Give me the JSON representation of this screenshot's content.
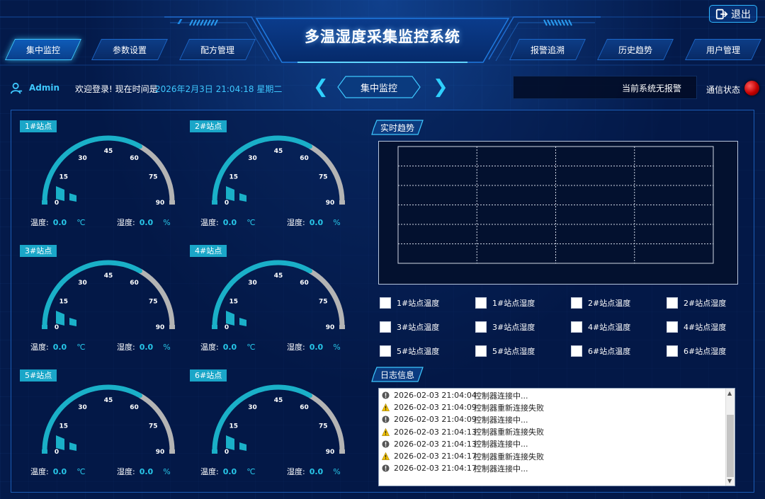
{
  "header": {
    "title": "多温湿度采集监控系统",
    "logout_label": "退出",
    "nav": [
      {
        "label": "集中监控",
        "active": true
      },
      {
        "label": "参数设置",
        "active": false
      },
      {
        "label": "配方管理",
        "active": false
      },
      {
        "label": "报警追溯",
        "active": false
      },
      {
        "label": "历史趋势",
        "active": false
      },
      {
        "label": "用户管理",
        "active": false
      }
    ]
  },
  "info_bar": {
    "user": "Admin",
    "welcome": "欢迎登录! 现在时间是",
    "time": "2026年2月3日 21:04:18 星期二",
    "prev_icon": "double-chevron-left-icon",
    "next_icon": "double-chevron-right-icon",
    "current_view": "集中监控",
    "alarm_text": "当前系统无报警",
    "comm_label": "通信状态",
    "comm_status_color": "#d10000"
  },
  "gauge_scale": [
    "0",
    "15",
    "30",
    "45",
    "60",
    "75",
    "90"
  ],
  "stations": [
    {
      "name": "1#站点",
      "temp_label": "温度:",
      "temp_value": "0.0",
      "temp_unit": "℃",
      "hum_label": "湿度:",
      "hum_value": "0.0",
      "hum_unit": "%"
    },
    {
      "name": "2#站点",
      "temp_label": "温度:",
      "temp_value": "0.0",
      "temp_unit": "℃",
      "hum_label": "湿度:",
      "hum_value": "0.0",
      "hum_unit": "%"
    },
    {
      "name": "3#站点",
      "temp_label": "温度:",
      "temp_value": "0.0",
      "temp_unit": "℃",
      "hum_label": "湿度:",
      "hum_value": "0.0",
      "hum_unit": "%"
    },
    {
      "name": "4#站点",
      "temp_label": "温度:",
      "temp_value": "0.0",
      "temp_unit": "℃",
      "hum_label": "湿度:",
      "hum_value": "0.0",
      "hum_unit": "%"
    },
    {
      "name": "5#站点",
      "temp_label": "温度:",
      "temp_value": "0.0",
      "temp_unit": "℃",
      "hum_label": "湿度:",
      "hum_value": "0.0",
      "hum_unit": "%"
    },
    {
      "name": "6#站点",
      "temp_label": "温度:",
      "temp_value": "0.0",
      "temp_unit": "℃",
      "hum_label": "湿度:",
      "hum_value": "0.0",
      "hum_unit": "%"
    }
  ],
  "trend": {
    "title": "实时趋势",
    "legend": [
      "1#站点温度",
      "1#站点湿度",
      "2#站点温度",
      "2#站点湿度",
      "3#站点温度",
      "3#站点湿度",
      "4#站点温度",
      "4#站点湿度",
      "5#站点温度",
      "5#站点湿度",
      "6#站点温度",
      "6#站点湿度"
    ]
  },
  "log": {
    "title": "日志信息",
    "entries": [
      {
        "type": "info",
        "time": "2026-02-03 21:04:04",
        "message": "控制器连接中..."
      },
      {
        "type": "warn",
        "time": "2026-02-03 21:04:09",
        "message": "控制器重新连接失败"
      },
      {
        "type": "info",
        "time": "2026-02-03 21:04:09",
        "message": "控制器连接中..."
      },
      {
        "type": "warn",
        "time": "2026-02-03 21:04:13",
        "message": "控制器重新连接失败"
      },
      {
        "type": "info",
        "time": "2026-02-03 21:04:13",
        "message": "控制器连接中..."
      },
      {
        "type": "warn",
        "time": "2026-02-03 21:04:17",
        "message": "控制器重新连接失败"
      },
      {
        "type": "info",
        "time": "2026-02-03 21:04:17",
        "message": "控制器连接中..."
      }
    ]
  },
  "colors": {
    "accent": "#3ec8ff",
    "gauge_teal": "#1ab0c8",
    "gauge_grey": "#b4b4b4",
    "background": "#041a4a"
  }
}
